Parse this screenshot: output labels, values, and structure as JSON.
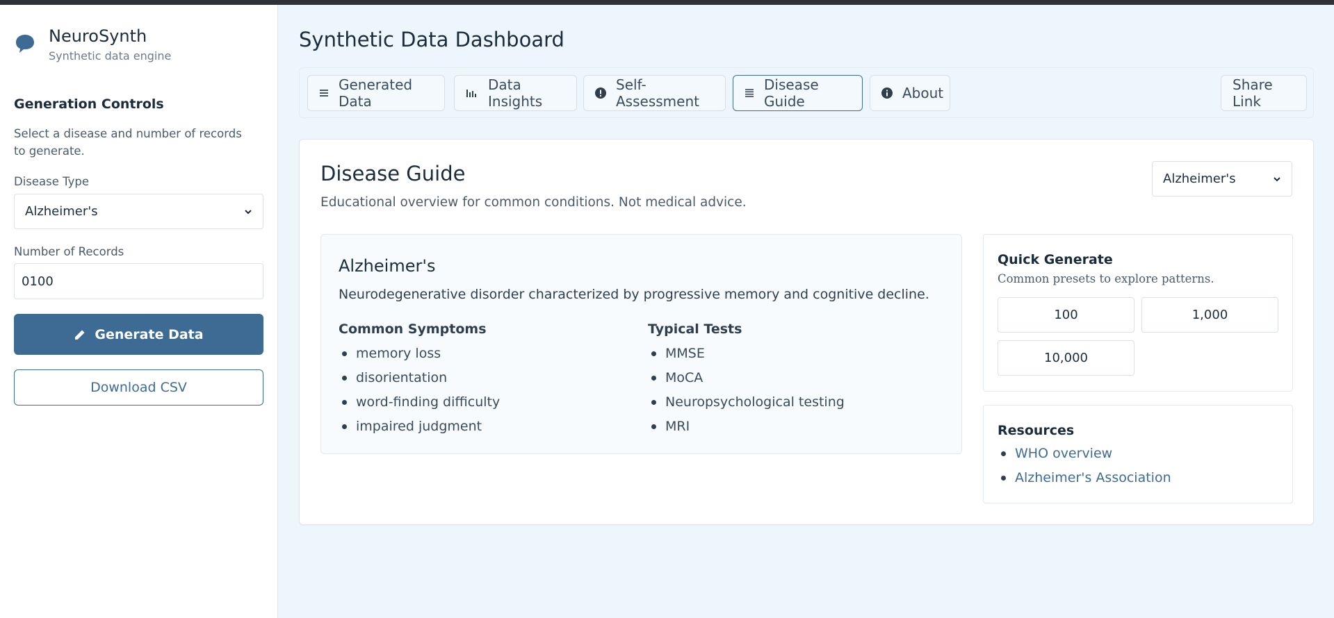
{
  "brand": {
    "name": "NeuroSynth",
    "subtitle": "Synthetic data engine",
    "icon": "brain-chat-icon"
  },
  "sidebar": {
    "heading": "Generation Controls",
    "description": "Select a disease and number of records to generate.",
    "disease_label": "Disease Type",
    "disease_value": "Alzheimer's",
    "records_label": "Number of Records",
    "records_value": "0100",
    "generate_label": "Generate Data",
    "download_label": "Download CSV"
  },
  "page_title": "Synthetic Data Dashboard",
  "tabs": [
    {
      "label": "Generated Data",
      "icon": "list-icon"
    },
    {
      "label": "Data Insights",
      "icon": "bar-chart-icon"
    },
    {
      "label": "Self-Assessment",
      "icon": "exclamation-icon"
    },
    {
      "label": "Disease Guide",
      "icon": "guide-list-icon",
      "active": true
    },
    {
      "label": "About",
      "icon": "info-icon"
    }
  ],
  "share_label": "Share Link",
  "guide": {
    "title": "Disease Guide",
    "subtitle": "Educational overview for common conditions. Not medical advice.",
    "select_value": "Alzheimer's",
    "disease": {
      "name": "Alzheimer's",
      "description": "Neurodegenerative disorder characterized by progressive memory and cognitive decline.",
      "symptoms_heading": "Common Symptoms",
      "symptoms": [
        "memory loss",
        "disorientation",
        "word-finding difficulty",
        "impaired judgment"
      ],
      "tests_heading": "Typical Tests",
      "tests": [
        "MMSE",
        "MoCA",
        "Neuropsychological testing",
        "MRI"
      ]
    },
    "quick_generate": {
      "title": "Quick Generate",
      "subtitle": "Common presets to explore patterns.",
      "presets": [
        "100",
        "1,000",
        "10,000"
      ]
    },
    "resources": {
      "title": "Resources",
      "links": [
        "WHO overview",
        "Alzheimer's Association"
      ]
    }
  },
  "colors": {
    "accent": "#3d6b94",
    "background": "#eef6fd"
  }
}
